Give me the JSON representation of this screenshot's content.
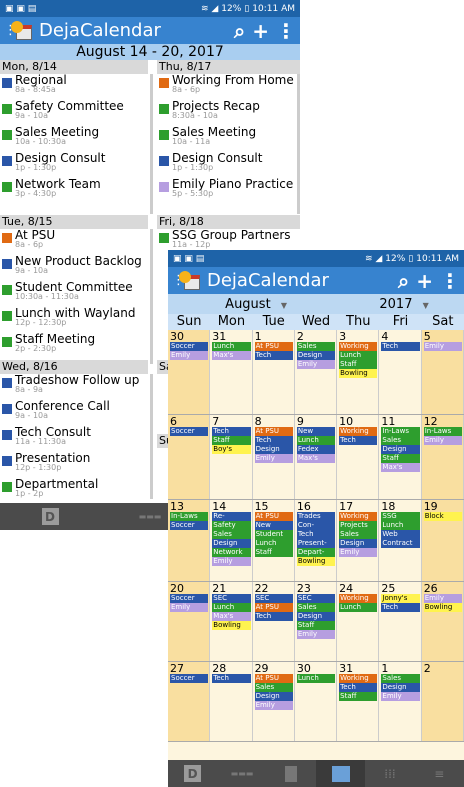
{
  "colors": {
    "blue": "#2a56a8",
    "green": "#2e9e2e",
    "orange": "#e06a13",
    "purple": "#b69ee0",
    "yellow": "#fff34f",
    "teal": "#2e9e2e"
  },
  "status": {
    "left_icons": "▣ ▣ ▤",
    "signal": "≋ ◢",
    "battery": "12%",
    "time": "10:11 AM"
  },
  "status2": {
    "left_icons": "▣ ▣ ▤",
    "signal": "≋ ◢",
    "battery": "12%",
    "time": "10:11 AM"
  },
  "app": {
    "title": "DejaCalendar",
    "menu_icon": "menu-icon",
    "search_icon": "search-icon",
    "add_icon": "add-icon",
    "more_icon": "more-icon"
  },
  "week": {
    "range": "August 14 - 20, 2017",
    "days": [
      {
        "label": "Mon, 8/14",
        "events": [
          {
            "title": "Regional",
            "time": "8a - 8:45a",
            "color": "#2a56a8"
          },
          {
            "title": "Safety Committee",
            "time": "9a - 10a",
            "color": "#2e9e2e"
          },
          {
            "title": "Sales Meeting",
            "time": "10a - 10:30a",
            "color": "#2e9e2e",
            "icon": true
          },
          {
            "title": "Design Consult",
            "time": "1p - 1:30p",
            "color": "#2a56a8",
            "icon": true
          },
          {
            "title": "Network Team",
            "time": "3p - 4:30p",
            "color": "#2e9e2e"
          }
        ]
      },
      {
        "label": "Thu, 8/17",
        "events": [
          {
            "title": "Working From Home",
            "time": "8a - 6p",
            "color": "#e06a13",
            "icon": true
          },
          {
            "title": "Projects Recap",
            "time": "8:30a - 10a",
            "color": "#2e9e2e"
          },
          {
            "title": "Sales Meeting",
            "time": "10a - 11a",
            "color": "#2e9e2e",
            "icon": true
          },
          {
            "title": "Design Consult",
            "time": "1p - 1:30p",
            "color": "#2a56a8",
            "icon": true
          },
          {
            "title": "Emily Piano Practice",
            "time": "5p - 5:30p",
            "color": "#b69ee0",
            "icon": true
          }
        ]
      },
      {
        "label": "Tue, 8/15",
        "events": [
          {
            "title": "At PSU",
            "time": "8a - 6p",
            "color": "#e06a13",
            "icon": true
          },
          {
            "title": "New Product Backlog",
            "time": "9a - 10a",
            "color": "#2a56a8"
          },
          {
            "title": "Student Committee",
            "time": "10:30a - 11:30a",
            "color": "#2e9e2e"
          },
          {
            "title": "Lunch with Wayland",
            "time": "12p - 12:30p",
            "color": "#2e9e2e",
            "icon": true
          },
          {
            "title": "Staff Meeting",
            "time": "2p - 2:30p",
            "color": "#2e9e2e",
            "icon": true
          }
        ]
      },
      {
        "label": "Fri, 8/18",
        "events": [
          {
            "title": "SSG Group Partners",
            "time": "11a - 12p",
            "color": "#2e9e2e"
          }
        ]
      },
      {
        "label": "Wed, 8/16",
        "events": [
          {
            "title": "Tradeshow Follow up",
            "time": "8a - 9a",
            "color": "#2a56a8"
          },
          {
            "title": "Conference Call",
            "time": "9a - 10a",
            "color": "#2a56a8"
          },
          {
            "title": "Tech Consult",
            "time": "11a - 11:30a",
            "color": "#2a56a8",
            "icon": true
          },
          {
            "title": "Presentation",
            "time": "12p - 1:30p",
            "color": "#2a56a8"
          },
          {
            "title": "Departmental",
            "time": "1p - 2p",
            "color": "#2e9e2e"
          }
        ]
      },
      {
        "label": "Sa",
        "events": []
      },
      {
        "label": "Su",
        "events": []
      }
    ]
  },
  "month": {
    "month": "August",
    "year": "2017",
    "dow": [
      "Sun",
      "Mon",
      "Tue",
      "Wed",
      "Thu",
      "Fri",
      "Sat"
    ],
    "weeks": [
      [
        {
          "d": "30",
          "e": [
            [
              "Soccer",
              "#2a56a8"
            ],
            [
              "Emily",
              "#b69ee0"
            ]
          ]
        },
        {
          "d": "31",
          "e": [
            [
              "Lunch",
              "#2e9e2e"
            ],
            [
              "Max's",
              "#b69ee0"
            ]
          ]
        },
        {
          "d": "1",
          "e": [
            [
              "At PSU",
              "#e06a13"
            ],
            [
              "Tech",
              "#2a56a8"
            ]
          ]
        },
        {
          "d": "2",
          "e": [
            [
              "Sales",
              "#2e9e2e"
            ],
            [
              "Design",
              "#2a56a8"
            ],
            [
              "Emily",
              "#b69ee0"
            ]
          ]
        },
        {
          "d": "3",
          "e": [
            [
              "Working",
              "#e06a13"
            ],
            [
              "Lunch",
              "#2e9e2e"
            ],
            [
              "Staff",
              "#2e9e2e"
            ],
            [
              "Bowling",
              "#fff34f"
            ]
          ]
        },
        {
          "d": "4",
          "e": [
            [
              "Tech",
              "#2a56a8"
            ]
          ]
        },
        {
          "d": "5",
          "e": [
            [
              "Emily",
              "#b69ee0"
            ]
          ]
        }
      ],
      [
        {
          "d": "6",
          "e": [
            [
              "Soccer",
              "#2a56a8"
            ]
          ]
        },
        {
          "d": "7",
          "e": [
            [
              "Tech",
              "#2a56a8"
            ],
            [
              "Staff",
              "#2e9e2e"
            ],
            [
              "Boy's",
              "#fff34f"
            ]
          ]
        },
        {
          "d": "8",
          "e": [
            [
              "At PSU",
              "#e06a13"
            ],
            [
              "Tech",
              "#2a56a8"
            ],
            [
              "Design",
              "#2a56a8"
            ],
            [
              "Emily",
              "#b69ee0"
            ]
          ]
        },
        {
          "d": "9",
          "e": [
            [
              "New",
              "#2a56a8"
            ],
            [
              "Lunch",
              "#2e9e2e"
            ],
            [
              "Fedex",
              "#2a56a8"
            ],
            [
              "Max's",
              "#b69ee0"
            ]
          ]
        },
        {
          "d": "10",
          "e": [
            [
              "Working",
              "#e06a13"
            ],
            [
              "Tech",
              "#2a56a8"
            ]
          ]
        },
        {
          "d": "11",
          "e": [
            [
              "In-Laws",
              "#2e9e2e"
            ],
            [
              "Sales",
              "#2e9e2e"
            ],
            [
              "Design",
              "#2a56a8"
            ],
            [
              "Staff",
              "#2e9e2e"
            ],
            [
              "Max's",
              "#b69ee0"
            ]
          ]
        },
        {
          "d": "12",
          "e": [
            [
              "In-Laws",
              "#2e9e2e"
            ],
            [
              "Emily",
              "#b69ee0"
            ]
          ]
        }
      ],
      [
        {
          "d": "13",
          "e": [
            [
              "In-Laws",
              "#2e9e2e"
            ],
            [
              "Soccer",
              "#2a56a8"
            ]
          ]
        },
        {
          "d": "14",
          "e": [
            [
              "Re-",
              "#2a56a8"
            ],
            [
              "Safety",
              "#2e9e2e"
            ],
            [
              "Sales",
              "#2e9e2e"
            ],
            [
              "Design",
              "#2a56a8"
            ],
            [
              "Network",
              "#2e9e2e"
            ],
            [
              "Emily",
              "#b69ee0"
            ]
          ]
        },
        {
          "d": "15",
          "e": [
            [
              "At PSU",
              "#e06a13"
            ],
            [
              "New",
              "#2a56a8"
            ],
            [
              "Student",
              "#2e9e2e"
            ],
            [
              "Lunch",
              "#2e9e2e"
            ],
            [
              "Staff",
              "#2e9e2e"
            ]
          ]
        },
        {
          "d": "16",
          "e": [
            [
              "Trades",
              "#2a56a8"
            ],
            [
              "Con-",
              "#2a56a8"
            ],
            [
              "Tech",
              "#2a56a8"
            ],
            [
              "Present-",
              "#2a56a8"
            ],
            [
              "Depart-",
              "#2e9e2e"
            ],
            [
              "Bowling",
              "#fff34f"
            ]
          ]
        },
        {
          "d": "17",
          "e": [
            [
              "Working",
              "#e06a13"
            ],
            [
              "Projects",
              "#2e9e2e"
            ],
            [
              "Sales",
              "#2e9e2e"
            ],
            [
              "Design",
              "#2a56a8"
            ],
            [
              "Emily",
              "#b69ee0"
            ]
          ]
        },
        {
          "d": "18",
          "e": [
            [
              "SSG",
              "#2e9e2e"
            ],
            [
              "Lunch",
              "#2e9e2e"
            ],
            [
              "Web",
              "#2a56a8"
            ],
            [
              "Contract",
              "#2a56a8"
            ]
          ]
        },
        {
          "d": "19",
          "e": [
            [
              "Block",
              "#fff34f"
            ]
          ]
        }
      ],
      [
        {
          "d": "20",
          "e": [
            [
              "Soccer",
              "#2a56a8"
            ],
            [
              "Emily",
              "#b69ee0"
            ]
          ]
        },
        {
          "d": "21",
          "e": [
            [
              "SEC",
              "#2a56a8"
            ],
            [
              "Lunch",
              "#2e9e2e"
            ],
            [
              "Max's",
              "#b69ee0"
            ],
            [
              "Bowling",
              "#fff34f"
            ]
          ]
        },
        {
          "d": "22",
          "e": [
            [
              "SEC",
              "#2a56a8"
            ],
            [
              "At PSU",
              "#e06a13"
            ],
            [
              "Tech",
              "#2a56a8"
            ]
          ]
        },
        {
          "d": "23",
          "e": [
            [
              "SEC",
              "#2a56a8"
            ],
            [
              "Sales",
              "#2e9e2e"
            ],
            [
              "Design",
              "#2a56a8"
            ],
            [
              "Staff",
              "#2e9e2e"
            ],
            [
              "Emily",
              "#b69ee0"
            ]
          ]
        },
        {
          "d": "24",
          "e": [
            [
              "Working",
              "#e06a13"
            ],
            [
              "Lunch",
              "#2e9e2e"
            ]
          ]
        },
        {
          "d": "25",
          "e": [
            [
              "Jonny's",
              "#fff34f"
            ],
            [
              "Tech",
              "#2a56a8"
            ]
          ]
        },
        {
          "d": "26",
          "e": [
            [
              "Emily",
              "#b69ee0"
            ],
            [
              "Bowling",
              "#fff34f"
            ]
          ]
        }
      ],
      [
        {
          "d": "27",
          "e": [
            [
              "Soccer",
              "#2a56a8"
            ]
          ]
        },
        {
          "d": "28",
          "e": [
            [
              "Tech",
              "#2a56a8"
            ]
          ]
        },
        {
          "d": "29",
          "e": [
            [
              "At PSU",
              "#e06a13"
            ],
            [
              "Sales",
              "#2e9e2e"
            ],
            [
              "Design",
              "#2a56a8"
            ],
            [
              "Emily",
              "#b69ee0"
            ]
          ]
        },
        {
          "d": "30",
          "e": [
            [
              "Lunch",
              "#2e9e2e"
            ]
          ]
        },
        {
          "d": "31",
          "e": [
            [
              "Working",
              "#e06a13"
            ],
            [
              "Tech",
              "#2a56a8"
            ],
            [
              "Staff",
              "#2e9e2e"
            ]
          ]
        },
        {
          "d": "1",
          "e": [
            [
              "Sales",
              "#2e9e2e"
            ],
            [
              "Design",
              "#2a56a8"
            ],
            [
              "Emily",
              "#b69ee0"
            ]
          ]
        },
        {
          "d": "2",
          "e": []
        }
      ]
    ]
  },
  "nav": {
    "d_label": "D",
    "items": [
      "day-view-icon",
      "agenda-view-icon",
      "week-view-icon",
      "month-view-icon",
      "year-view-icon",
      "list-view-icon"
    ]
  }
}
